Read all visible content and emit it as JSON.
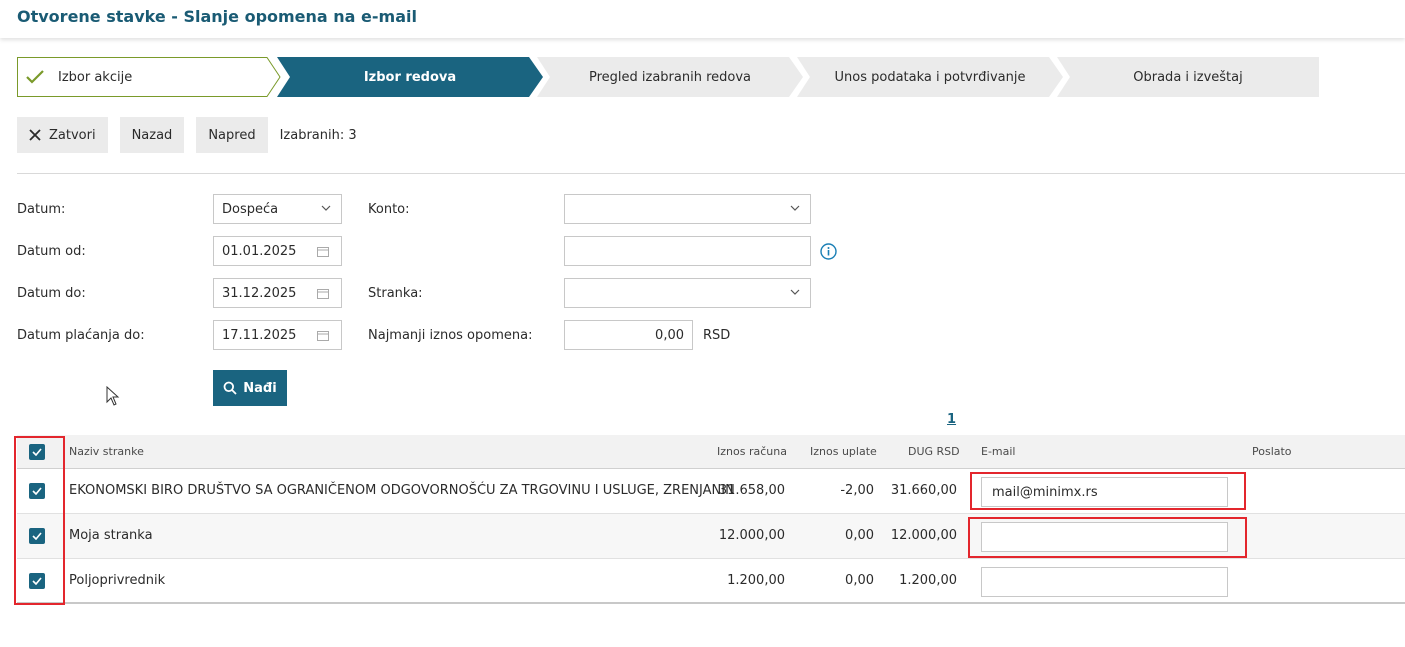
{
  "page_title": "Otvorene stavke - Slanje opomena na e-mail",
  "steps": [
    {
      "label": "Izbor akcije",
      "state": "done"
    },
    {
      "label": "Izbor redova",
      "state": "active"
    },
    {
      "label": "Pregled izabranih redova",
      "state": "pending"
    },
    {
      "label": "Unos podataka i potvrđivanje",
      "state": "pending"
    },
    {
      "label": "Obrada i izveštaj",
      "state": "pending"
    }
  ],
  "toolbar": {
    "close_label": "Zatvori",
    "back_label": "Nazad",
    "next_label": "Napred",
    "selected_count": "Izabranih: 3"
  },
  "filters": {
    "datum_label": "Datum:",
    "datum_value": "Dospeća",
    "datum_od_label": "Datum od:",
    "datum_od_value": "01.01.2025",
    "datum_do_label": "Datum do:",
    "datum_do_value": "31.12.2025",
    "datum_placanja_label": "Datum plaćanja do:",
    "datum_placanja_value": "17.11.2025",
    "konto_label": "Konto:",
    "konto_value": "",
    "konto_extra_value": "",
    "stranka_label": "Stranka:",
    "stranka_value": "",
    "min_iznos_label": "Najmanji iznos opomena:",
    "min_iznos_value": "0,00",
    "currency": "RSD"
  },
  "search_label": "Nađi",
  "pagination": {
    "current_page": "1"
  },
  "table": {
    "headers": {
      "naziv": "Naziv stranke",
      "iznos_racuna": "Iznos računa",
      "iznos_uplate": "Iznos uplate",
      "dug": "DUG RSD",
      "email": "E-mail",
      "poslato": "Poslato"
    },
    "rows": [
      {
        "naziv": "EKONOMSKI BIRO DRUŠTVO SA OGRANIČENOM ODGOVORNOŠĆU ZA TRGOVINU I USLUGE, ZRENJANIN",
        "iznos_racuna": "31.658,00",
        "iznos_uplate": "-2,00",
        "dug": "31.660,00",
        "email": "mail@minimx.rs",
        "poslato": "",
        "checked": true
      },
      {
        "naziv": "Moja stranka",
        "iznos_racuna": "12.000,00",
        "iznos_uplate": "0,00",
        "dug": "12.000,00",
        "email": "",
        "poslato": "",
        "checked": true
      },
      {
        "naziv": "Poljoprivrednik",
        "iznos_racuna": "1.200,00",
        "iznos_uplate": "0,00",
        "dug": "1.200,00",
        "email": "",
        "poslato": "",
        "checked": true
      }
    ]
  },
  "colors": {
    "primary": "#1a6480",
    "title": "#1a5b74",
    "highlight": "#e3262d",
    "check_done": "#7a9a2a"
  },
  "icons": [
    "checkmark-icon",
    "close-icon",
    "chevron-down-icon",
    "calendar-icon",
    "info-icon",
    "search-icon",
    "mouse-cursor-icon"
  ]
}
